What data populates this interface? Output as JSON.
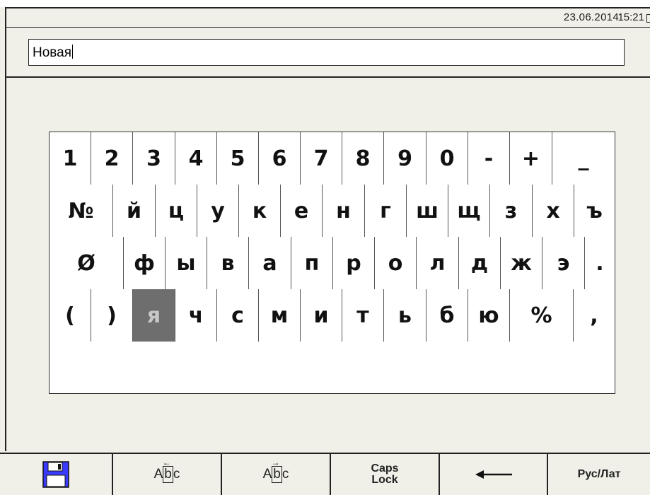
{
  "statusbar": {
    "date": "23.06.2014",
    "time": "15:21"
  },
  "input": {
    "value": "Новая"
  },
  "keyboard": {
    "rows": [
      [
        {
          "l": "1"
        },
        {
          "l": "2"
        },
        {
          "l": "3"
        },
        {
          "l": "4"
        },
        {
          "l": "5"
        },
        {
          "l": "6"
        },
        {
          "l": "7"
        },
        {
          "l": "8"
        },
        {
          "l": "9"
        },
        {
          "l": "0"
        },
        {
          "l": "-"
        },
        {
          "l": "+"
        },
        {
          "l": "_"
        }
      ],
      [
        {
          "l": "№"
        },
        {
          "l": "й"
        },
        {
          "l": "ц"
        },
        {
          "l": "у"
        },
        {
          "l": "к"
        },
        {
          "l": "е"
        },
        {
          "l": "н"
        },
        {
          "l": "г"
        },
        {
          "l": "ш"
        },
        {
          "l": "щ"
        },
        {
          "l": "з"
        },
        {
          "l": "х"
        },
        {
          "l": "ъ"
        }
      ],
      [
        {
          "l": "Ø"
        },
        {
          "l": "ф"
        },
        {
          "l": "ы"
        },
        {
          "l": "в"
        },
        {
          "l": "а"
        },
        {
          "l": "п"
        },
        {
          "l": "р"
        },
        {
          "l": "о"
        },
        {
          "l": "л"
        },
        {
          "l": "д"
        },
        {
          "l": "ж"
        },
        {
          "l": "э"
        },
        {
          "l": "."
        }
      ],
      [
        {
          "l": "("
        },
        {
          "l": ")"
        },
        {
          "l": "я",
          "selected": true
        },
        {
          "l": "ч"
        },
        {
          "l": "с"
        },
        {
          "l": "м"
        },
        {
          "l": "и"
        },
        {
          "l": "т"
        },
        {
          "l": "ь"
        },
        {
          "l": "б"
        },
        {
          "l": "ю"
        },
        {
          "l": "%"
        },
        {
          "l": ","
        }
      ],
      [
        {
          "l": ""
        }
      ]
    ]
  },
  "bottombar": {
    "buttons": [
      {
        "name": "save-button",
        "icon": "floppy-disk-icon"
      },
      {
        "name": "cursor-left-button",
        "text": "Abc",
        "arrow": "←"
      },
      {
        "name": "cursor-right-button",
        "text": "Abc",
        "arrow": "→"
      },
      {
        "name": "caps-lock-button",
        "label": "Caps\nLock"
      },
      {
        "name": "backspace-button",
        "icon": "left-arrow-icon"
      },
      {
        "name": "language-toggle-button",
        "label": "Рус/Лат"
      }
    ]
  },
  "colors": {
    "selected_key": "#6e6e6e",
    "background": "#f0f0e8",
    "save_icon": "#3a3aff"
  }
}
